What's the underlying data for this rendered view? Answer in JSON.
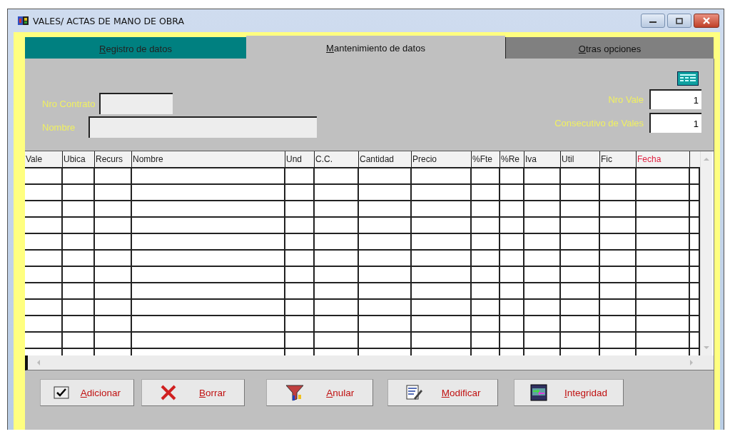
{
  "window": {
    "title": "VALES/ ACTAS DE MANO DE OBRA"
  },
  "tabs": [
    {
      "label": "Registro de datos",
      "selected": false,
      "kind": "teal"
    },
    {
      "label": "Mantenimiento de datos",
      "selected": true,
      "kind": "plain"
    },
    {
      "label": "Otras opciones",
      "selected": false,
      "kind": "dark"
    }
  ],
  "fields_left": [
    {
      "label": "Nro Contrato",
      "kind": "short"
    },
    {
      "label": "Nombre",
      "kind": "long"
    }
  ],
  "fields_right": [
    {
      "label": "Nro Vale",
      "value": "1"
    },
    {
      "label": "Consecutivo de Vales",
      "value": "1"
    }
  ],
  "table": {
    "columns": [
      {
        "label": "Vale",
        "emphasis": false
      },
      {
        "label": "Ubica",
        "emphasis": false
      },
      {
        "label": "Recurs",
        "emphasis": false
      },
      {
        "label": "Nombre",
        "emphasis": false
      },
      {
        "label": "Und",
        "emphasis": false
      },
      {
        "label": "C.C.",
        "emphasis": false
      },
      {
        "label": "Cantidad",
        "emphasis": false
      },
      {
        "label": "Precio",
        "emphasis": false
      },
      {
        "label": "%Fte",
        "emphasis": false
      },
      {
        "label": "%Re",
        "emphasis": false
      },
      {
        "label": "Iva",
        "emphasis": false
      },
      {
        "label": "Util",
        "emphasis": false
      },
      {
        "label": "Fic",
        "emphasis": false
      },
      {
        "label": "Fecha",
        "emphasis": true
      }
    ]
  },
  "buttons": [
    {
      "label": "Adicionar",
      "kind": "check"
    },
    {
      "label": "Borrar",
      "kind": "cross"
    },
    {
      "label": "Anular",
      "kind": "funnel"
    },
    {
      "label": "Modificar",
      "kind": "edit"
    },
    {
      "label": "Integridad",
      "kind": "arrows"
    }
  ]
}
